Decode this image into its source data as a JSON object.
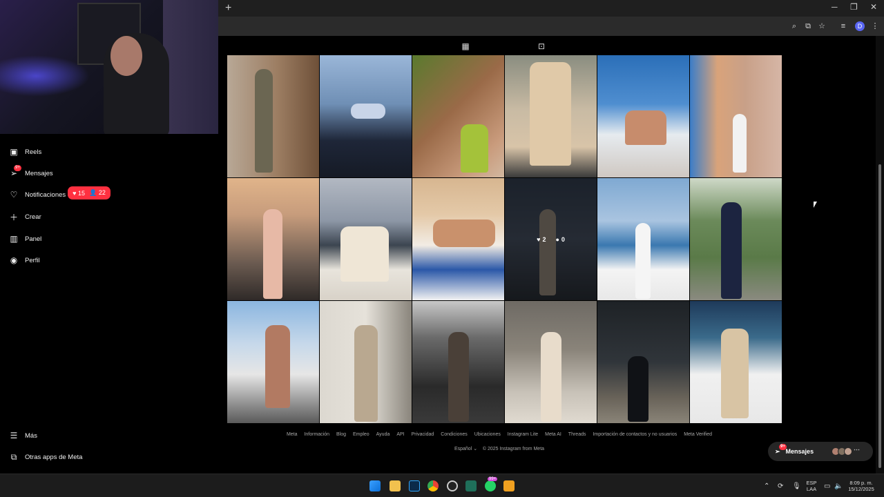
{
  "browser": {
    "new_tab_glyph": "+",
    "window_controls": [
      "─",
      "❐",
      "✕"
    ],
    "toolbar_icons": [
      "search-icon",
      "install-icon",
      "bookmark-star-icon",
      "media-icon",
      "menu-dots-icon"
    ],
    "profile_initial": "D"
  },
  "sidebar": {
    "items": [
      {
        "label": "Reels",
        "icon": "reels-icon"
      },
      {
        "label": "Mensajes",
        "icon": "messenger-icon",
        "badge": "9+"
      },
      {
        "label": "Notificaciones",
        "icon": "heart-icon"
      },
      {
        "label": "Crear",
        "icon": "plus-icon"
      },
      {
        "label": "Panel",
        "icon": "dashboard-icon"
      },
      {
        "label": "Perfil",
        "icon": "profile-avatar-icon"
      }
    ],
    "notifications_popup": {
      "likes": "15",
      "followers": "22"
    },
    "bottom_items": [
      {
        "label": "Más",
        "icon": "hamburger-icon"
      },
      {
        "label": "Otras apps de Meta",
        "icon": "meta-apps-icon"
      }
    ]
  },
  "profile": {
    "tabs": [
      "grid-icon",
      "tagged-icon"
    ],
    "hover_post": {
      "likes": "2",
      "comments": "0"
    }
  },
  "footer": {
    "links": [
      "Meta",
      "Información",
      "Blog",
      "Empleo",
      "Ayuda",
      "API",
      "Privacidad",
      "Condiciones",
      "Ubicaciones",
      "Instagram Lite",
      "Meta AI",
      "Threads",
      "Importación de contactos y no usuarios",
      "Meta Verified"
    ],
    "language": "Español",
    "copyright": "© 2025 Instagram from Meta"
  },
  "messages_bubble": {
    "label": "Mensajes",
    "badge": "9+"
  },
  "taskbar": {
    "lang_top": "ESP",
    "lang_bottom": "LAA",
    "time": "8:09 p. m.",
    "date": "15/12/2025",
    "whatsapp_badge": "99+"
  },
  "colors": {
    "accent_red": "#ff3040",
    "background": "#000000"
  }
}
